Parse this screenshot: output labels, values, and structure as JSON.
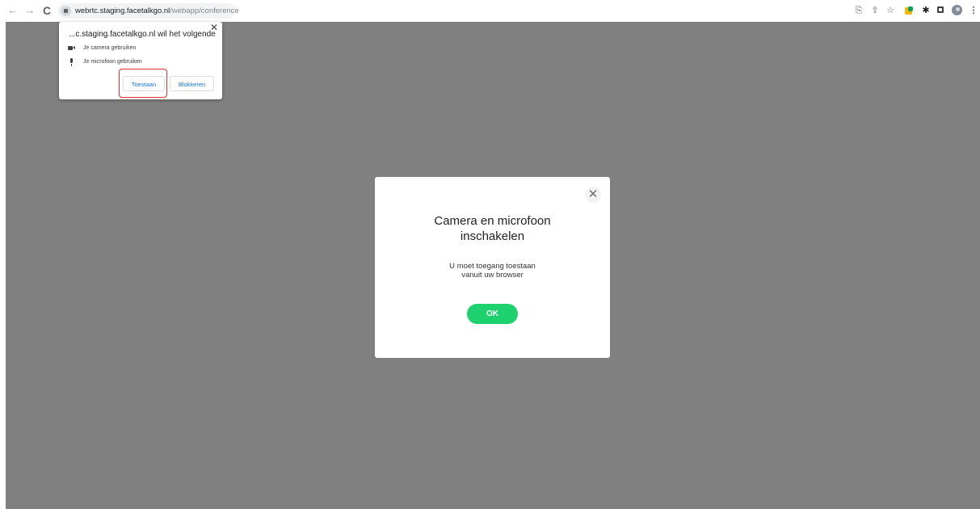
{
  "browser": {
    "url_host": "webrtc.staging.facetalkgo.nl",
    "url_path": "/webapp/conference",
    "icons": [
      "back-icon",
      "forward-icon",
      "reload-icon",
      "lock-icon",
      "translate-icon",
      "share-icon",
      "bookmark-star-icon",
      "extension-icon",
      "extensions-puzzle-icon",
      "side-panel-icon",
      "profile-avatar-icon",
      "menu-kebab-icon"
    ]
  },
  "permission_popup": {
    "title": "...c.staging.facetalkgo.nl wil het volgende",
    "camera_label": "Je camera gebruiken",
    "microphone_label": "Je microfoon gebruiken",
    "allow_label": "Toestaan",
    "block_label": "Blokkeren",
    "highlight_color": "#e03030"
  },
  "modal": {
    "title_line1": "Camera en microfoon",
    "title_line2": "inschakelen",
    "text_line1": "U moet toegang toestaan",
    "text_line2": "vanuit uw browser",
    "ok_label": "OK",
    "ok_color": "#1ed16f",
    "backdrop_color": "#808080"
  }
}
